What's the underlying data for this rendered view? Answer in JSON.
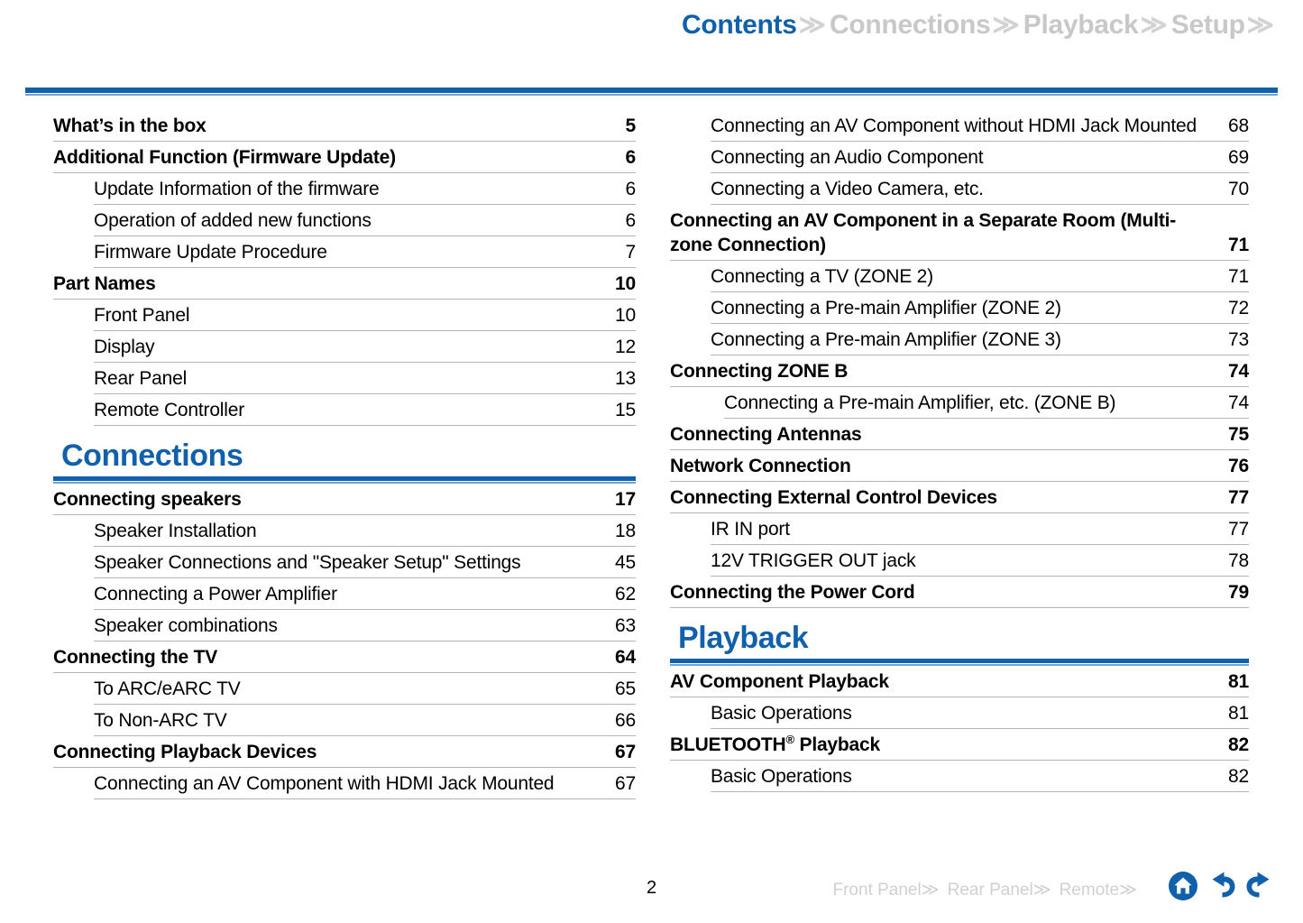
{
  "header": {
    "tabs": [
      {
        "label": "Contents",
        "state": "active",
        "chevron": "≫"
      },
      {
        "label": "Connections",
        "state": "inactive",
        "chevron": "≫"
      },
      {
        "label": "Playback",
        "state": "inactive",
        "chevron": "≫"
      },
      {
        "label": "Setup",
        "state": "inactive",
        "chevron": "≫"
      }
    ]
  },
  "colors": {
    "accent_blue": "#1160ac",
    "light_blue": "#6ba3d6",
    "inactive_gray": "#c8c8c8",
    "rule_gray": "#b4b4b4"
  },
  "left_column": {
    "entries": [
      {
        "level": 1,
        "label": "What’s in the box",
        "page": "5"
      },
      {
        "level": 1,
        "label": "Additional Function (Firmware Update)",
        "page": "6"
      },
      {
        "level": 2,
        "label": "Update Information of the firmware",
        "page": "6"
      },
      {
        "level": 2,
        "label": "Operation of added new functions",
        "page": "6"
      },
      {
        "level": 2,
        "label": "Firmware Update Procedure",
        "page": "7"
      },
      {
        "level": 1,
        "label": "Part Names",
        "page": "10"
      },
      {
        "level": 2,
        "label": "Front Panel",
        "page": "10"
      },
      {
        "level": 2,
        "label": "Display",
        "page": "12"
      },
      {
        "level": 2,
        "label": "Rear Panel",
        "page": "13"
      },
      {
        "level": 2,
        "label": "Remote Controller",
        "page": "15"
      }
    ],
    "section": {
      "title": "Connections"
    },
    "entries_after_section": [
      {
        "level": 1,
        "label": "Connecting speakers",
        "page": "17"
      },
      {
        "level": 2,
        "label": "Speaker Installation",
        "page": "18"
      },
      {
        "level": 2,
        "label": "Speaker Connections and \"Speaker Setup\" Settings",
        "page": "45"
      },
      {
        "level": 2,
        "label": "Connecting a Power Amplifier",
        "page": "62"
      },
      {
        "level": 2,
        "label": "Speaker combinations",
        "page": "63"
      },
      {
        "level": 1,
        "label": "Connecting the TV",
        "page": "64"
      },
      {
        "level": 2,
        "label": "To ARC/eARC TV",
        "page": "65"
      },
      {
        "level": 2,
        "label": "To Non-ARC TV",
        "page": "66"
      },
      {
        "level": 1,
        "label": "Connecting Playback Devices",
        "page": "67"
      },
      {
        "level": 2,
        "label": "Connecting an AV Component with HDMI Jack Mounted",
        "page": "67",
        "wrap": true
      }
    ]
  },
  "right_column": {
    "entries": [
      {
        "level": 2,
        "label": "Connecting an AV Component without HDMI Jack Mounted",
        "page": "68",
        "wrap": true
      },
      {
        "level": 2,
        "label": "Connecting an Audio Component",
        "page": "69"
      },
      {
        "level": 2,
        "label": "Connecting a Video Camera, etc.",
        "page": "70"
      },
      {
        "level": 1,
        "label": "Connecting an AV Component in a Separate Room (Multi-zone Connection)",
        "page": "71",
        "wrap": true
      },
      {
        "level": 2,
        "label": "Connecting a TV (ZONE 2)",
        "page": "71"
      },
      {
        "level": 2,
        "label": "Connecting a Pre-main Amplifier (ZONE 2)",
        "page": "72"
      },
      {
        "level": 2,
        "label": "Connecting a Pre-main Amplifier (ZONE 3)",
        "page": "73"
      },
      {
        "level": 1,
        "label": "Connecting ZONE B",
        "page": "74"
      },
      {
        "level": 2,
        "label": "Connecting a Pre-main Amplifier, etc. (ZONE B)",
        "page": "74",
        "indent_more": true
      },
      {
        "level": 1,
        "label": "Connecting Antennas",
        "page": "75"
      },
      {
        "level": 1,
        "label": "Network Connection",
        "page": "76"
      },
      {
        "level": 1,
        "label": "Connecting External Control Devices",
        "page": "77"
      },
      {
        "level": 2,
        "label": "IR IN port",
        "page": "77"
      },
      {
        "level": 2,
        "label": "12V TRIGGER OUT jack",
        "page": "78"
      },
      {
        "level": 1,
        "label": "Connecting the Power Cord",
        "page": "79"
      }
    ],
    "section": {
      "title": "Playback"
    },
    "entries_after_section": [
      {
        "level": 1,
        "label": "AV Component Playback",
        "page": "81"
      },
      {
        "level": 2,
        "label": "Basic Operations",
        "page": "81"
      },
      {
        "level": 1,
        "label": "BLUETOOTH® Playback",
        "page": "82",
        "superscript": "®",
        "base": "BLUETOOTH",
        "tail": " Playback"
      },
      {
        "level": 2,
        "label": "Basic Operations",
        "page": "82"
      }
    ]
  },
  "footer": {
    "page_number": "2",
    "nav": [
      {
        "label": "Front Panel",
        "chevron": "≫"
      },
      {
        "label": "Rear Panel",
        "chevron": "≫"
      },
      {
        "label": "Remote",
        "chevron": "≫"
      }
    ],
    "icons": [
      {
        "name": "home-icon"
      },
      {
        "name": "back-arrow-icon"
      },
      {
        "name": "forward-arrow-icon"
      }
    ]
  }
}
